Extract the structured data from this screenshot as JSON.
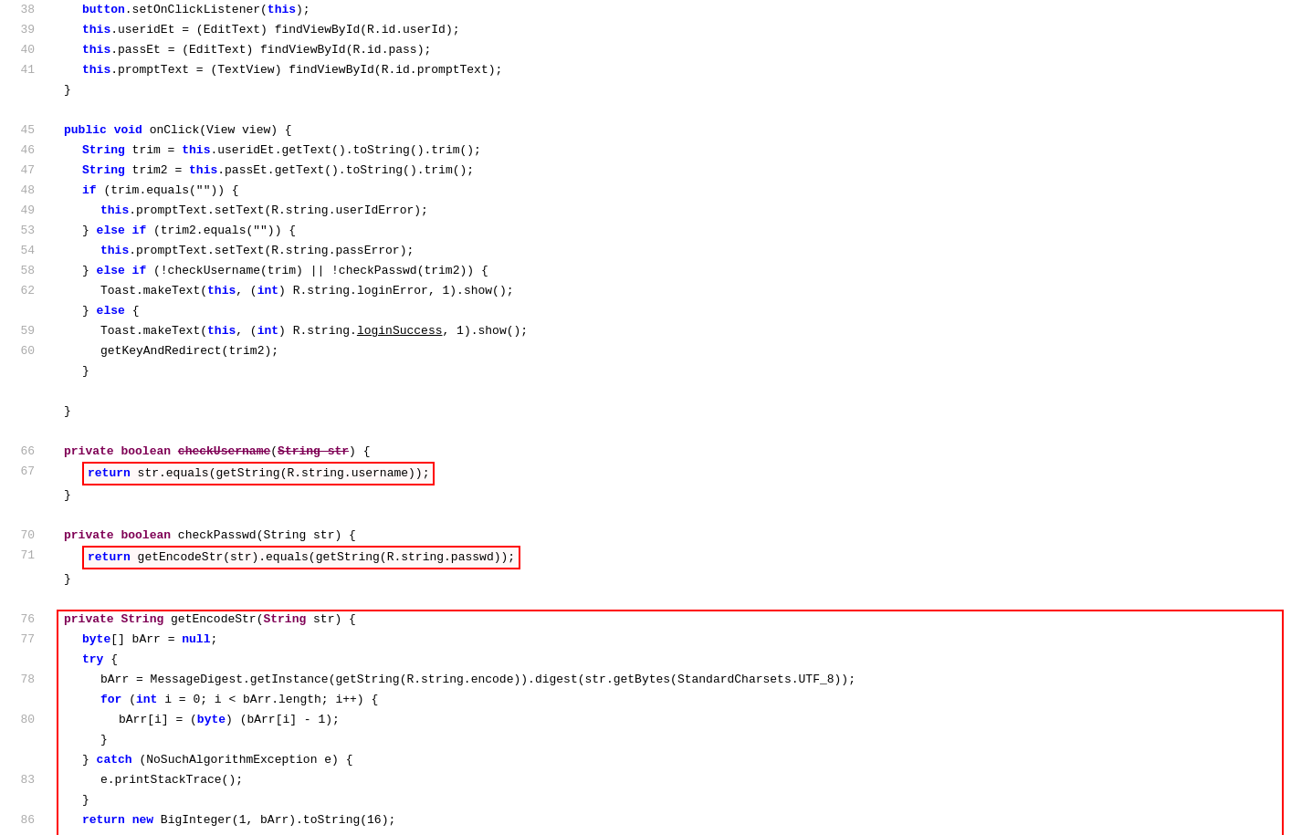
{
  "editor": {
    "background": "#ffffff",
    "lines": [
      {
        "num": 38,
        "indent": 2,
        "tokens": [
          {
            "t": "kw",
            "v": "button"
          },
          {
            "t": "plain",
            "v": ".setOnClickListener("
          },
          {
            "t": "kw",
            "v": "this"
          },
          {
            "t": "plain",
            "v": ");"
          }
        ]
      },
      {
        "num": 39,
        "indent": 2,
        "tokens": [
          {
            "t": "kw",
            "v": "this"
          },
          {
            "t": "plain",
            "v": ".useridEt = (EditText) findViewById(R.id.userId);"
          }
        ]
      },
      {
        "num": 40,
        "indent": 2,
        "tokens": [
          {
            "t": "kw",
            "v": "this"
          },
          {
            "t": "plain",
            "v": ".passEt = (EditText) findViewById(R.id.pass);"
          }
        ]
      },
      {
        "num": 41,
        "indent": 2,
        "tokens": [
          {
            "t": "kw",
            "v": "this"
          },
          {
            "t": "plain",
            "v": ".promptText = (TextView) findViewById(R.id.promptText);"
          }
        ]
      },
      {
        "num": null,
        "indent": 1,
        "tokens": [
          {
            "t": "plain",
            "v": "}"
          }
        ]
      },
      {
        "num": null
      },
      {
        "num": 45,
        "indent": 1,
        "tokens": [
          {
            "t": "kw",
            "v": "public"
          },
          {
            "t": "plain",
            "v": " "
          },
          {
            "t": "kw",
            "v": "void"
          },
          {
            "t": "plain",
            "v": " onClick(View view) {"
          }
        ]
      },
      {
        "num": 46,
        "indent": 2,
        "tokens": [
          {
            "t": "kw",
            "v": "String"
          },
          {
            "t": "plain",
            "v": " trim = "
          },
          {
            "t": "kw",
            "v": "this"
          },
          {
            "t": "plain",
            "v": ".useridEt.getText().toString().trim();"
          }
        ]
      },
      {
        "num": 47,
        "indent": 2,
        "tokens": [
          {
            "t": "kw",
            "v": "String"
          },
          {
            "t": "plain",
            "v": " trim2 = "
          },
          {
            "t": "kw",
            "v": "this"
          },
          {
            "t": "plain",
            "v": ".passEt.getText().toString().trim();"
          }
        ]
      },
      {
        "num": 48,
        "indent": 2,
        "tokens": [
          {
            "t": "kw",
            "v": "if"
          },
          {
            "t": "plain",
            "v": " (trim.equals(\"\")) {"
          }
        ]
      },
      {
        "num": 49,
        "indent": 3,
        "tokens": [
          {
            "t": "kw",
            "v": "this"
          },
          {
            "t": "plain",
            "v": ".promptText.setText(R.string.userIdError);"
          }
        ]
      },
      {
        "num": 53,
        "indent": 2,
        "tokens": [
          {
            "t": "plain",
            "v": "} "
          },
          {
            "t": "kw",
            "v": "else if"
          },
          {
            "t": "plain",
            "v": " (trim2.equals(\"\")) {"
          }
        ]
      },
      {
        "num": 54,
        "indent": 3,
        "tokens": [
          {
            "t": "kw",
            "v": "this"
          },
          {
            "t": "plain",
            "v": ".promptText.setText(R.string.passError);"
          }
        ]
      },
      {
        "num": 58,
        "indent": 2,
        "tokens": [
          {
            "t": "plain",
            "v": "} "
          },
          {
            "t": "kw",
            "v": "else if"
          },
          {
            "t": "plain",
            "v": " (!checkUsername(trim) || !checkPasswd(trim2)) {"
          }
        ]
      },
      {
        "num": 62,
        "indent": 3,
        "tokens": [
          {
            "t": "plain",
            "v": "Toast.makeText("
          },
          {
            "t": "kw",
            "v": "this"
          },
          {
            "t": "plain",
            "v": ", ("
          },
          {
            "t": "kw",
            "v": "int"
          },
          {
            "t": "plain",
            "v": ") R.string.loginError, 1).show();"
          }
        ]
      },
      {
        "num": null,
        "indent": 2,
        "tokens": [
          {
            "t": "plain",
            "v": "} "
          },
          {
            "t": "kw",
            "v": "else"
          },
          {
            "t": "plain",
            "v": " {"
          }
        ]
      },
      {
        "num": 59,
        "indent": 3,
        "tokens": [
          {
            "t": "plain",
            "v": "Toast.makeText("
          },
          {
            "t": "kw",
            "v": "this"
          },
          {
            "t": "plain",
            "v": ", ("
          },
          {
            "t": "kw",
            "v": "int"
          },
          {
            "t": "plain",
            "v": ") R.string."
          },
          {
            "t": "underline",
            "v": "loginSuccess"
          },
          {
            "t": "plain",
            "v": ", 1).show();"
          }
        ]
      },
      {
        "num": 60,
        "indent": 3,
        "tokens": [
          {
            "t": "plain",
            "v": "getKeyAndRedirect(trim2);"
          }
        ]
      },
      {
        "num": null,
        "indent": 2,
        "tokens": [
          {
            "t": "plain",
            "v": "}"
          }
        ]
      },
      {
        "num": null
      },
      {
        "num": null,
        "indent": 1,
        "tokens": [
          {
            "t": "plain",
            "v": "}"
          }
        ]
      },
      {
        "num": null
      },
      {
        "num": 66,
        "indent": 1,
        "tokens": [
          {
            "t": "kw2",
            "v": "private"
          },
          {
            "t": "plain",
            "v": " "
          },
          {
            "t": "kw2",
            "v": "boolean"
          },
          {
            "t": "plain",
            "v": " "
          },
          {
            "t": "strikethrough",
            "v": "checkUsername"
          },
          {
            "t": "plain",
            "v": "("
          },
          {
            "t": "strikethrough",
            "v": "String str"
          },
          {
            "t": "plain",
            "v": ") {"
          }
        ]
      },
      {
        "num": 67,
        "indent": 2,
        "tokens": [
          {
            "t": "kw",
            "v": "return"
          },
          {
            "t": "plain",
            "v": " str.equals(getString(R.string.username));"
          }
        ],
        "redbox": true
      },
      {
        "num": null,
        "indent": 1,
        "tokens": [
          {
            "t": "plain",
            "v": "}"
          }
        ]
      },
      {
        "num": null
      },
      {
        "num": 70,
        "indent": 1,
        "tokens": [
          {
            "t": "kw2",
            "v": "private"
          },
          {
            "t": "plain",
            "v": " "
          },
          {
            "t": "kw2",
            "v": "boolean"
          },
          {
            "t": "plain",
            "v": " checkPasswd(String str) {"
          }
        ]
      },
      {
        "num": 71,
        "indent": 2,
        "tokens": [
          {
            "t": "kw",
            "v": "return"
          },
          {
            "t": "plain",
            "v": " getEncodeStr(str).equals(getString(R.string.passwd));"
          }
        ],
        "redbox": true
      },
      {
        "num": null,
        "indent": 1,
        "tokens": [
          {
            "t": "plain",
            "v": "}"
          }
        ]
      },
      {
        "num": null
      },
      {
        "num": 76,
        "indent": 1,
        "tokens": [
          {
            "t": "kw2",
            "v": "private"
          },
          {
            "t": "plain",
            "v": " "
          },
          {
            "t": "kw2",
            "v": "String"
          },
          {
            "t": "plain",
            "v": " getEncodeStr("
          },
          {
            "t": "kw2",
            "v": "String"
          },
          {
            "t": "plain",
            "v": " str) {"
          }
        ],
        "bigbox_start": true
      },
      {
        "num": 77,
        "indent": 2,
        "tokens": [
          {
            "t": "kw",
            "v": "byte"
          },
          {
            "t": "plain",
            "v": "[] bArr = "
          },
          {
            "t": "kw",
            "v": "null"
          },
          {
            "t": "plain",
            "v": ";"
          }
        ]
      },
      {
        "num": null,
        "indent": 2,
        "tokens": [
          {
            "t": "kw",
            "v": "try"
          },
          {
            "t": "plain",
            "v": " {"
          }
        ]
      },
      {
        "num": 78,
        "indent": 3,
        "tokens": [
          {
            "t": "plain",
            "v": "bArr = MessageDigest.getInstance(getString(R.string.encode)).digest(str.getBytes(StandardCharsets.UTF_8));"
          }
        ]
      },
      {
        "num": null,
        "indent": 3,
        "tokens": [
          {
            "t": "kw",
            "v": "for"
          },
          {
            "t": "plain",
            "v": " ("
          },
          {
            "t": "kw",
            "v": "int"
          },
          {
            "t": "plain",
            "v": " i = 0; i < bArr.length; i++) {"
          }
        ]
      },
      {
        "num": 80,
        "indent": 4,
        "tokens": [
          {
            "t": "plain",
            "v": "bArr[i] = ("
          },
          {
            "t": "kw",
            "v": "byte"
          },
          {
            "t": "plain",
            "v": ") (bArr[i] - 1);"
          }
        ]
      },
      {
        "num": null,
        "indent": 3,
        "tokens": [
          {
            "t": "plain",
            "v": "}"
          }
        ]
      },
      {
        "num": null,
        "indent": 2,
        "tokens": [
          {
            "t": "plain",
            "v": "} "
          },
          {
            "t": "kw",
            "v": "catch"
          },
          {
            "t": "plain",
            "v": " (NoSuchAlgorithmException e) {"
          }
        ]
      },
      {
        "num": 83,
        "indent": 3,
        "tokens": [
          {
            "t": "plain",
            "v": "e.printStackTrace();"
          }
        ]
      },
      {
        "num": null,
        "indent": 2,
        "tokens": [
          {
            "t": "plain",
            "v": "}"
          }
        ]
      },
      {
        "num": 86,
        "indent": 2,
        "tokens": [
          {
            "t": "kw",
            "v": "return"
          },
          {
            "t": "plain",
            "v": " "
          },
          {
            "t": "kw",
            "v": "new"
          },
          {
            "t": "plain",
            "v": " BigInteger(1, bArr).toString(16);"
          }
        ]
      },
      {
        "num": null,
        "indent": 1,
        "tokens": [
          {
            "t": "plain",
            "v": "}"
          }
        ]
      },
      {
        "num": null,
        "bigbox_end": true
      }
    ]
  }
}
